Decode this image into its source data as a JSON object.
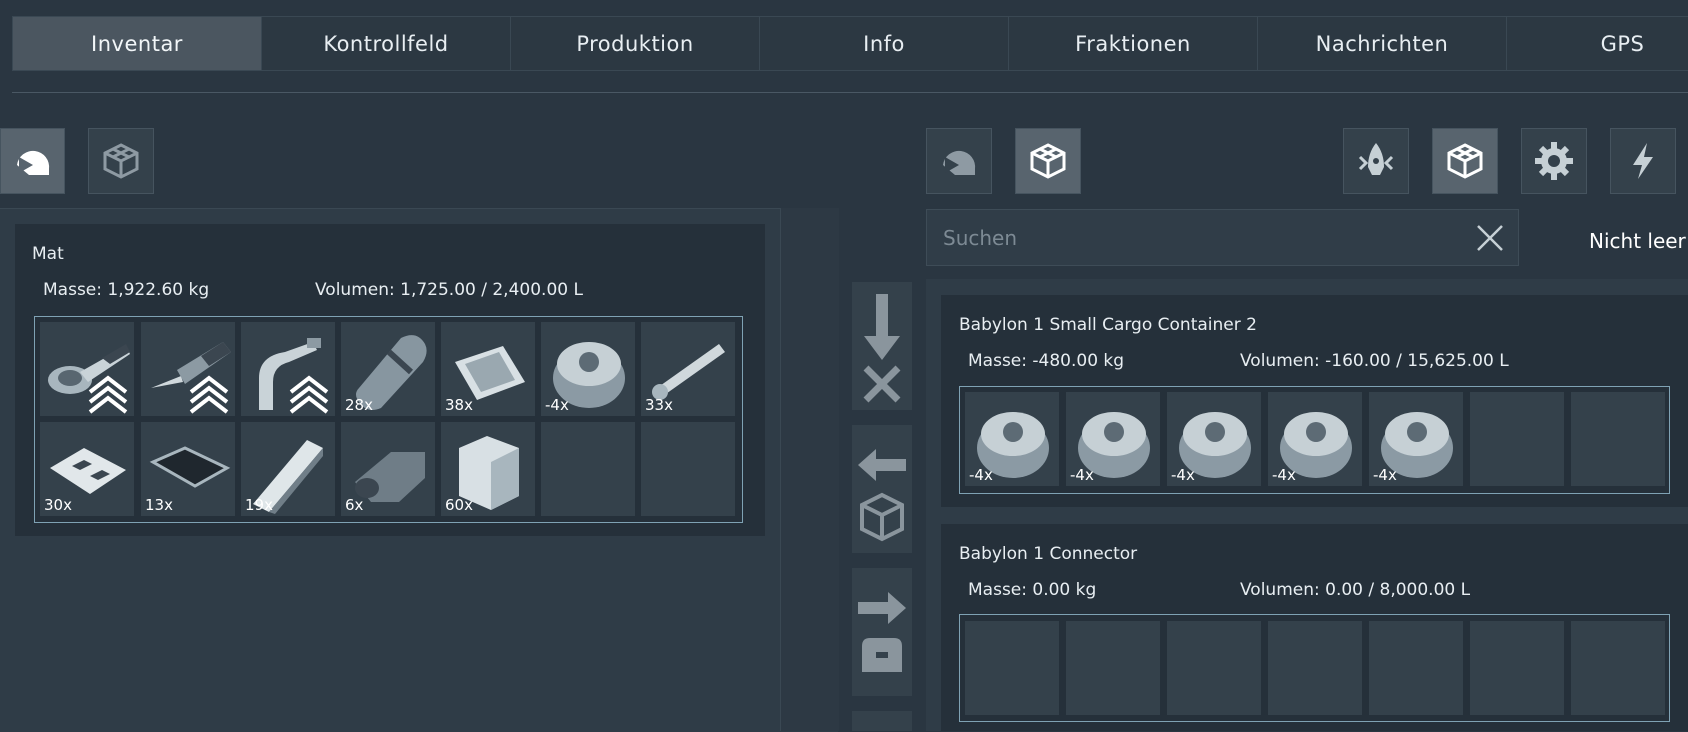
{
  "tabs": [
    "Inventar",
    "Kontrollfeld",
    "Produktion",
    "Info",
    "Fraktionen",
    "Nachrichten",
    "GPS"
  ],
  "active_tab": "Inventar",
  "left_inventory": {
    "name": "Mat",
    "mass": "Masse: 1,922.60 kg",
    "volume": "Volumen: 1,725.00 / 2,400.00 L",
    "items": [
      {
        "icon": "grinder-icon",
        "qty": "",
        "rank": true
      },
      {
        "icon": "drill-icon",
        "qty": "",
        "rank": true
      },
      {
        "icon": "welder-icon",
        "qty": "",
        "rank": true
      },
      {
        "icon": "hydrogen-bottle-icon",
        "qty": "28x"
      },
      {
        "icon": "computer-chip-icon",
        "qty": "38x"
      },
      {
        "icon": "motor-icon",
        "qty": "-4x"
      },
      {
        "icon": "small-tube-icon",
        "qty": "33x"
      },
      {
        "icon": "steel-plate-icon",
        "qty": "30x"
      },
      {
        "icon": "display-icon",
        "qty": "13x"
      },
      {
        "icon": "girder-icon",
        "qty": "19x"
      },
      {
        "icon": "rifle-icon",
        "qty": "6x"
      },
      {
        "icon": "construction-component-icon",
        "qty": "60x"
      },
      {
        "icon": "",
        "qty": ""
      },
      {
        "icon": "",
        "qty": ""
      }
    ]
  },
  "search": {
    "placeholder": "Suchen",
    "value": ""
  },
  "filter": "Nicht leer",
  "containers": [
    {
      "name": "Babylon 1 Small Cargo Container 2",
      "mass": "Masse: -480.00 kg",
      "volume": "Volumen: -160.00 / 15,625.00 L",
      "items": [
        "-4x",
        "-4x",
        "-4x",
        "-4x",
        "-4x",
        "",
        ""
      ]
    },
    {
      "name": "Babylon 1 Connector",
      "mass": "Masse: 0.00 kg",
      "volume": "Volumen: 0.00 / 8,000.00 L",
      "items": [
        "",
        "",
        "",
        "",
        "",
        "",
        ""
      ]
    }
  ],
  "colors": {
    "background": "#2a3641",
    "active_tab": "#4b5660",
    "grid_border": "#7fa2b4"
  }
}
